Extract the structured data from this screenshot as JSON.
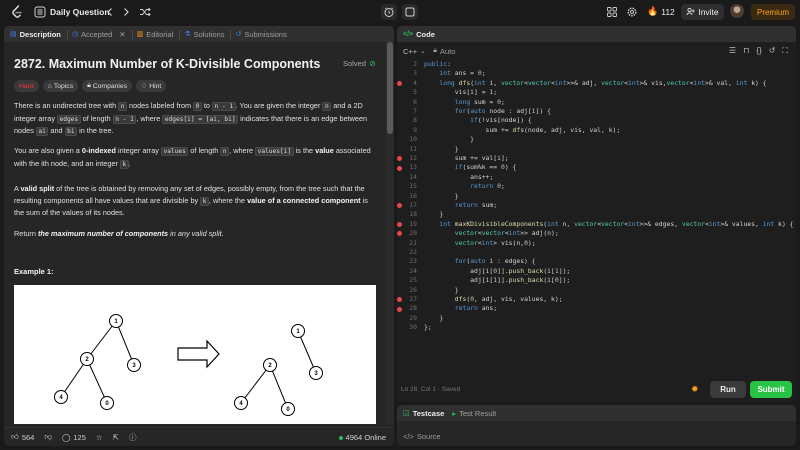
{
  "topbar": {
    "title": "Daily Question",
    "streak": "112",
    "invite_label": "Invite",
    "premium_label": "Premium"
  },
  "left_tabs": [
    {
      "label": "Description",
      "icon": "document-icon"
    },
    {
      "label": "Accepted",
      "icon": "clock-icon"
    },
    {
      "label": "Editorial",
      "icon": "book-icon"
    },
    {
      "label": "Solutions",
      "icon": "flask-icon"
    },
    {
      "label": "Submissions",
      "icon": "history-icon"
    }
  ],
  "problem": {
    "title": "2872. Maximum Number of K-Divisible Components",
    "solved": "Solved",
    "tags": [
      "Hard",
      "Topics",
      "Companies",
      "Hint"
    ],
    "p1_a": "There is an undirected tree with ",
    "p1_n": "n",
    "p1_b": " nodes labeled from ",
    "p1_0": "0",
    "p1_c": " to ",
    "p1_nm1": "n - 1",
    "p1_d": ". You are given the integer ",
    "p1_n2": "n",
    "p1_e": " and a 2D integer array ",
    "p1_edges": "edges",
    "p1_f": " of length ",
    "p1_nm1b": "n - 1",
    "p1_g": ", where ",
    "p1_edgei": "edges[i] = [ai, bi]",
    "p1_h": " indicates that there is an edge between nodes ",
    "p1_ai": "ai",
    "p1_i": " and ",
    "p1_bi": "bi",
    "p1_j": " in the tree.",
    "p2_a": "You are also given a ",
    "p2_b": "0-indexed",
    "p2_c": " integer array ",
    "p2_values": "values",
    "p2_d": " of length ",
    "p2_n": "n",
    "p2_e": ", where ",
    "p2_vi": "values[i]",
    "p2_f": " is the ",
    "p2_g": "value",
    "p2_h": " associated with the ",
    "p2_ith": "ith",
    "p2_i": " node, and an integer ",
    "p2_k": "k",
    "p2_j": ".",
    "p3_a": "A ",
    "p3_b": "valid split",
    "p3_c": " of the tree is obtained by removing any set of edges, possibly empty, from the tree such that the resulting components all have values that are divisible by ",
    "p3_k": "k",
    "p3_d": ", where the ",
    "p3_e": "value of a connected component",
    "p3_f": " is the sum of the values of its nodes.",
    "p4_a": "Return ",
    "p4_b": "the maximum number of components",
    "p4_c": " in any valid split.",
    "example_title": "Example 1:",
    "tree_left": [
      "1",
      "2",
      "3",
      "4",
      "0"
    ],
    "tree_right": [
      "1",
      "2",
      "3",
      "4",
      "0"
    ]
  },
  "left_footer": {
    "likes": "564",
    "comments": "125",
    "online": "4964 Online"
  },
  "code_panel": {
    "tab": "Code",
    "lang": "C++",
    "mode": "Auto",
    "status": "Ln 28, Col 1  ·  Saved",
    "run_label": "Run",
    "submit_label": "Submit",
    "lines": [
      {
        "n": "2",
        "bp": false,
        "t": "public:"
      },
      {
        "n": "3",
        "bp": false,
        "t": "    int ans = 0;"
      },
      {
        "n": "4",
        "bp": true,
        "t": "    long dfs(int i, vector<vector<int>>& adj, vector<int>& vis,vector<int>& val, int k) {"
      },
      {
        "n": "5",
        "bp": false,
        "t": "        vis[i] = 1;"
      },
      {
        "n": "6",
        "bp": false,
        "t": "        long sum = 0;"
      },
      {
        "n": "7",
        "bp": false,
        "t": "        for(auto node : adj[i]) {"
      },
      {
        "n": "8",
        "bp": false,
        "t": "            if(!vis[node]) {"
      },
      {
        "n": "9",
        "bp": false,
        "t": "                sum += dfs(node, adj, vis, val, k);"
      },
      {
        "n": "10",
        "bp": false,
        "t": "            }"
      },
      {
        "n": "11",
        "bp": false,
        "t": "        }"
      },
      {
        "n": "12",
        "bp": true,
        "t": "        sum += val[i];"
      },
      {
        "n": "13",
        "bp": true,
        "t": "        if(sum%k == 0) {"
      },
      {
        "n": "14",
        "bp": false,
        "t": "            ans++;"
      },
      {
        "n": "15",
        "bp": false,
        "t": "            return 0;"
      },
      {
        "n": "16",
        "bp": false,
        "t": "        }"
      },
      {
        "n": "17",
        "bp": true,
        "t": "        return sum;"
      },
      {
        "n": "18",
        "bp": false,
        "t": "    }"
      },
      {
        "n": "19",
        "bp": true,
        "t": "    int maxKDivisibleComponents(int n, vector<vector<int>>& edges, vector<int>& values, int k) {"
      },
      {
        "n": "20",
        "bp": true,
        "t": "        vector<vector<int>> adj(n);"
      },
      {
        "n": "21",
        "bp": false,
        "t": "        vector<int> vis(n,0);"
      },
      {
        "n": "22",
        "bp": false,
        "t": ""
      },
      {
        "n": "23",
        "bp": false,
        "t": "        for(auto i : edges) {"
      },
      {
        "n": "24",
        "bp": false,
        "t": "            adj[i[0]].push_back(i[1]);"
      },
      {
        "n": "25",
        "bp": false,
        "t": "            adj[i[1]].push_back(i[0]);"
      },
      {
        "n": "26",
        "bp": false,
        "t": "        }"
      },
      {
        "n": "27",
        "bp": true,
        "t": "        dfs(0, adj, vis, values, k);"
      },
      {
        "n": "28",
        "bp": true,
        "t": "        return ans;"
      },
      {
        "n": "29",
        "bp": false,
        "t": "    }"
      },
      {
        "n": "30",
        "bp": false,
        "t": "};"
      }
    ]
  },
  "bottom_panel": {
    "tabs": [
      "Testcase",
      "Test Result"
    ],
    "source": "Source"
  },
  "colors": {
    "accent_green": "#2cbb5d",
    "hard_red": "#f63737",
    "premium_orange": "#ffa116",
    "breakpoint": "#e5484d"
  }
}
